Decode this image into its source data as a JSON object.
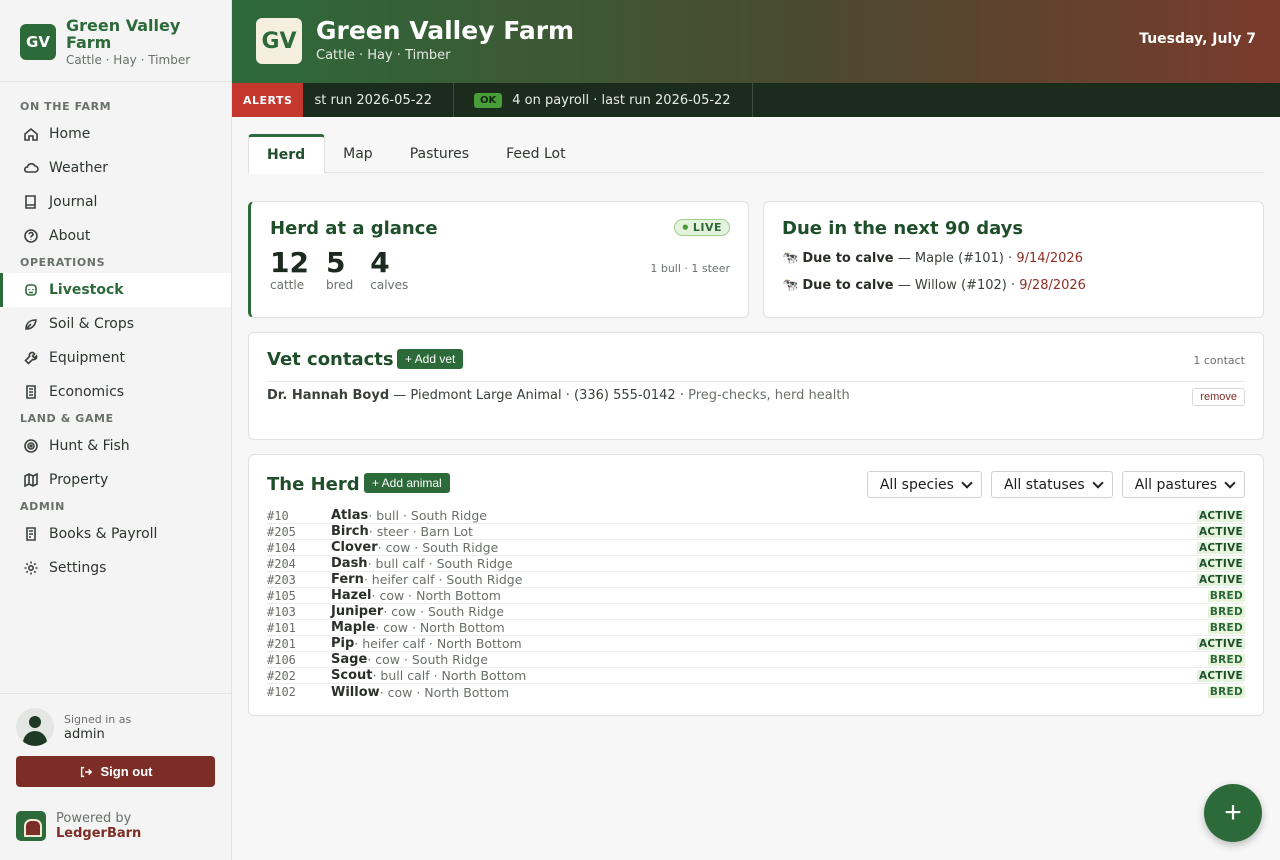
{
  "brand": {
    "logo": "GV",
    "name": "Green Valley Farm",
    "tagline": "Cattle · Hay · Timber"
  },
  "nav": {
    "sections": [
      {
        "title": "ON THE FARM",
        "items": [
          {
            "label": "Home",
            "icon": "home-icon"
          },
          {
            "label": "Weather",
            "icon": "cloud-icon"
          },
          {
            "label": "Journal",
            "icon": "book-icon"
          },
          {
            "label": "About",
            "icon": "help-icon"
          }
        ]
      },
      {
        "title": "OPERATIONS",
        "items": [
          {
            "label": "Livestock",
            "icon": "cow-icon",
            "active": true
          },
          {
            "label": "Soil & Crops",
            "icon": "leaf-icon"
          },
          {
            "label": "Equipment",
            "icon": "wrench-icon"
          },
          {
            "label": "Economics",
            "icon": "document-icon"
          }
        ]
      },
      {
        "title": "LAND & GAME",
        "items": [
          {
            "label": "Hunt & Fish",
            "icon": "target-icon"
          },
          {
            "label": "Property",
            "icon": "map-icon"
          }
        ]
      },
      {
        "title": "ADMIN",
        "items": [
          {
            "label": "Books & Payroll",
            "icon": "ledger-icon"
          },
          {
            "label": "Settings",
            "icon": "gear-icon"
          }
        ]
      }
    ]
  },
  "user": {
    "label": "Signed in as",
    "name": "admin",
    "signout": "Sign out"
  },
  "powered": {
    "label": "Powered by",
    "name": "LedgerBarn"
  },
  "header": {
    "logo": "GV",
    "title": "Green Valley Farm",
    "subtitle": "Cattle · Hay · Timber",
    "date": "Tuesday, July 7"
  },
  "alerts": {
    "tag": "ALERTS",
    "items": [
      {
        "text": "st run 2026-05-22"
      },
      {
        "badge": "OK",
        "text": "4 on payroll · last run 2026-05-22"
      }
    ]
  },
  "tabs": [
    {
      "label": "Herd",
      "active": true
    },
    {
      "label": "Map"
    },
    {
      "label": "Pastures"
    },
    {
      "label": "Feed Lot"
    }
  ],
  "glance": {
    "title": "Herd at a glance",
    "badge": "LIVE",
    "stats": [
      {
        "value": "12",
        "label": "cattle"
      },
      {
        "value": "5",
        "label": "bred"
      },
      {
        "value": "4",
        "label": "calves"
      }
    ],
    "note": "1 bull · 1 steer"
  },
  "due": {
    "title": "Due in the next 90 days",
    "items": [
      {
        "icon": "🐄",
        "label": "Due to calve",
        "detail": " — Maple (#101) · ",
        "date": "9/14/2026"
      },
      {
        "icon": "🐄",
        "label": "Due to calve",
        "detail": " — Willow (#102) · ",
        "date": "9/28/2026"
      }
    ]
  },
  "vets": {
    "title": "Vet contacts",
    "add": "+ Add vet",
    "count": "1 contact",
    "contact": {
      "name": "Dr. Hannah Boyd",
      "detail": " — Piedmont Large Animal · (336) 555-0142 · ",
      "note": "Preg-checks, herd health"
    },
    "remove": "remove"
  },
  "herd": {
    "title": "The Herd",
    "add": "+ Add animal",
    "filters": [
      "All species",
      "All statuses",
      "All pastures"
    ],
    "animals": [
      {
        "id": "#10",
        "name": "Atlas",
        "meta": " · bull · South Ridge",
        "status": "ACTIVE"
      },
      {
        "id": "#205",
        "name": "Birch",
        "meta": " · steer · Barn Lot",
        "status": "ACTIVE"
      },
      {
        "id": "#104",
        "name": "Clover",
        "meta": " · cow · South Ridge",
        "status": "ACTIVE"
      },
      {
        "id": "#204",
        "name": "Dash",
        "meta": " · bull calf · South Ridge",
        "status": "ACTIVE"
      },
      {
        "id": "#203",
        "name": "Fern",
        "meta": " · heifer calf · South Ridge",
        "status": "ACTIVE"
      },
      {
        "id": "#105",
        "name": "Hazel",
        "meta": " · cow · North Bottom",
        "status": "BRED"
      },
      {
        "id": "#103",
        "name": "Juniper",
        "meta": " · cow · South Ridge",
        "status": "BRED"
      },
      {
        "id": "#101",
        "name": "Maple",
        "meta": " · cow · North Bottom",
        "status": "BRED"
      },
      {
        "id": "#201",
        "name": "Pip",
        "meta": " · heifer calf · North Bottom",
        "status": "ACTIVE"
      },
      {
        "id": "#106",
        "name": "Sage",
        "meta": " · cow · South Ridge",
        "status": "BRED"
      },
      {
        "id": "#202",
        "name": "Scout",
        "meta": " · bull calf · North Bottom",
        "status": "ACTIVE"
      },
      {
        "id": "#102",
        "name": "Willow",
        "meta": " · cow · North Bottom",
        "status": "BRED"
      }
    ]
  },
  "fab": {
    "label": "+"
  },
  "colors": {
    "primary": "#2d6a3a",
    "danger": "#7c2e26",
    "alert": "#c4372c"
  }
}
